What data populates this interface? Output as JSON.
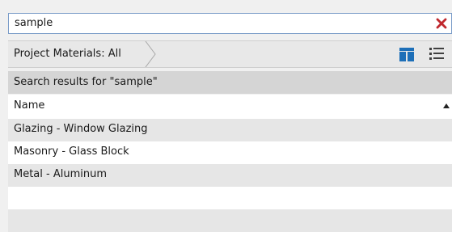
{
  "search": {
    "value": "sample",
    "clear_icon": "close-x-icon",
    "clear_color": "#c0282d"
  },
  "breadcrumb": {
    "label": "Project Materials: All"
  },
  "view_toggles": {
    "tile_icon": "tile-view-icon",
    "list_icon": "list-view-icon",
    "accent": "#1d6fb8"
  },
  "results": {
    "header": "Search results for \"sample\""
  },
  "table": {
    "column_name": "Name",
    "sort": "ascending",
    "rows": [
      "Glazing - Window Glazing",
      "Masonry - Glass Block",
      "Metal - Aluminum",
      "",
      "",
      ""
    ]
  }
}
